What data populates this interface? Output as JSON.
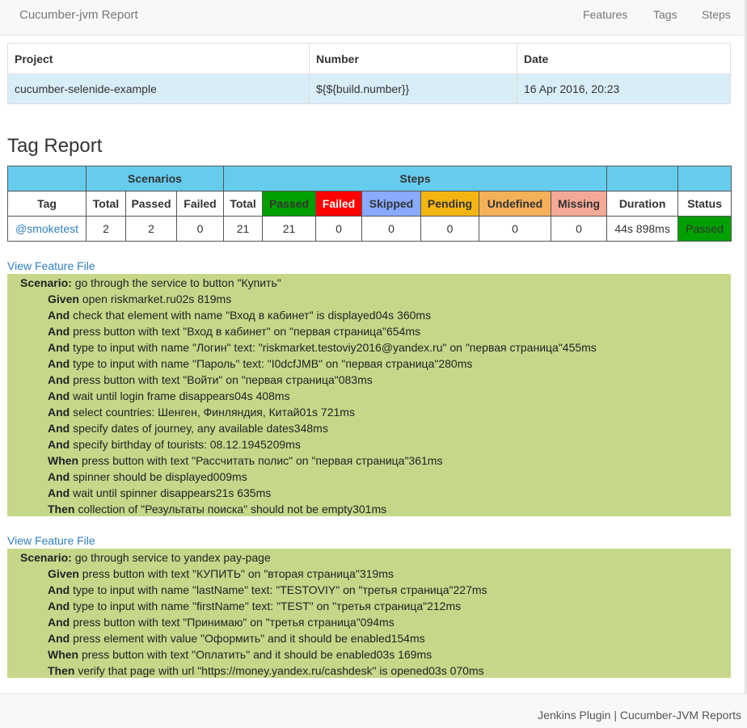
{
  "navbar": {
    "brand": "Cucumber-jvm Report",
    "links": [
      "Features",
      "Tags",
      "Steps"
    ]
  },
  "project_table": {
    "headers": [
      "Project",
      "Number",
      "Date"
    ],
    "row": [
      "cucumber-selenide-example",
      "${${build.number}}",
      "16 Apr 2016, 20:23"
    ]
  },
  "tag_report": {
    "title": "Tag Report",
    "group_headers": {
      "scenarios": "Scenarios",
      "steps": "Steps"
    },
    "columns": [
      "Tag",
      "Total",
      "Passed",
      "Failed",
      "Total",
      "Passed",
      "Failed",
      "Skipped",
      "Pending",
      "Undefined",
      "Missing",
      "Duration",
      "Status"
    ],
    "row": {
      "tag": "@smoketest",
      "scenarios_total": "2",
      "scenarios_passed": "2",
      "scenarios_failed": "0",
      "steps_total": "21",
      "steps_passed": "21",
      "steps_failed": "0",
      "steps_skipped": "0",
      "steps_pending": "0",
      "steps_undefined": "0",
      "steps_missing": "0",
      "duration": "44s 898ms",
      "status": "Passed"
    },
    "colors": {
      "header": "#66ccee",
      "passed": "#00a000",
      "failed": "#ff0000",
      "skipped": "#88aaff",
      "pending": "#f3b512",
      "undefined": "#f5b05a",
      "missing": "#f4a896",
      "scenario_bg": "#c5d88a"
    }
  },
  "features": [
    {
      "link": "View Feature File",
      "scenario_keyword": "Scenario:",
      "scenario_name": " go through the service to button \"Купить\"",
      "steps": [
        {
          "kw": "Given",
          "text": " open riskmarket.ru02s 819ms"
        },
        {
          "kw": "And",
          "text": " check that element with name \"Вход в кабинет\" is displayed04s 360ms"
        },
        {
          "kw": "And",
          "text": " press button with text \"Вход в кабинет\" on \"первая страница\"654ms"
        },
        {
          "kw": "And",
          "text": " type to input with name \"Логин\" text: \"riskmarket.testoviy2016@yandex.ru\" on \"первая страница\"455ms"
        },
        {
          "kw": "And",
          "text": " type to input with name \"Пароль\" text: \"I0dcfJMB\" on \"первая страница\"280ms"
        },
        {
          "kw": "And",
          "text": " press button with text \"Войти\" on \"первая страница\"083ms"
        },
        {
          "kw": "And",
          "text": " wait until login frame disappears04s 408ms"
        },
        {
          "kw": "And",
          "text": " select countries: Шенген, Финляндия, Китай01s 721ms"
        },
        {
          "kw": "And",
          "text": " specify dates of journey, any available dates348ms"
        },
        {
          "kw": "And",
          "text": " specify birthday of tourists: 08.12.1945209ms"
        },
        {
          "kw": "When",
          "text": " press button with text \"Рассчитать полис\" on \"первая страница\"361ms"
        },
        {
          "kw": "And",
          "text": " spinner should be displayed009ms"
        },
        {
          "kw": "And",
          "text": " wait until spinner disappears21s 635ms"
        },
        {
          "kw": "Then",
          "text": " collection of \"Результаты поиска\" should not be empty301ms"
        }
      ]
    },
    {
      "link": "View Feature File",
      "scenario_keyword": "Scenario:",
      "scenario_name": " go through service to yandex pay-page",
      "steps": [
        {
          "kw": "Given",
          "text": " press button with text \"КУПИТЬ\" on \"вторая страница\"319ms"
        },
        {
          "kw": "And",
          "text": " type to input with name \"lastName\" text: \"TESTOVIY\" on \"третья страница\"227ms"
        },
        {
          "kw": "And",
          "text": " type to input with name \"firstName\" text: \"TEST\" on \"третья страница\"212ms"
        },
        {
          "kw": "And",
          "text": " press button with text \"Принимаю\" on \"третья страница\"094ms"
        },
        {
          "kw": "And",
          "text": " press element with value \"Оформить\" and it should be enabled154ms"
        },
        {
          "kw": "When",
          "text": " press button with text \"Оплатить\" and it should be enabled03s 169ms"
        },
        {
          "kw": "Then",
          "text": " verify that page with url \"https://money.yandex.ru/cashdesk\" is opened03s 070ms"
        }
      ]
    }
  ],
  "footer": {
    "text": "Jenkins Plugin | Cucumber-JVM Reports"
  }
}
